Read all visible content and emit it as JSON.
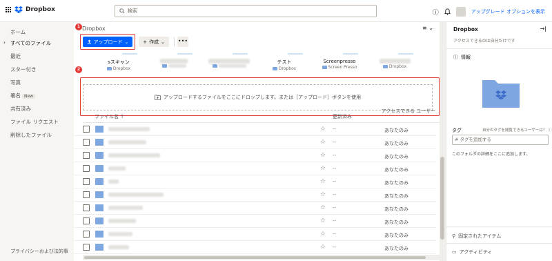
{
  "topbar": {
    "brand": "Dropbox",
    "search_placeholder": "検索",
    "upgrade_link": "アップグレード オプションを表示"
  },
  "sidebar": {
    "items": [
      {
        "label": "ホーム"
      },
      {
        "label": "すべてのファイル"
      },
      {
        "label": "最近"
      },
      {
        "label": "スター付き"
      },
      {
        "label": "写真"
      },
      {
        "label": "署名"
      },
      {
        "label": "共有済み"
      },
      {
        "label": "ファイル リクエスト"
      },
      {
        "label": "削除したファイル"
      }
    ],
    "new_badge": "New",
    "footer": "プライバシーおよび法的事"
  },
  "main": {
    "breadcrumb": "Dropbox",
    "badges": [
      "1",
      "2"
    ],
    "upload_label": "アップロード",
    "create_label": "作成",
    "more_label": "•••",
    "suggested": [
      {
        "title": "sスキャン",
        "sub": "Dropbox"
      },
      {
        "title": "",
        "sub": ""
      },
      {
        "title": "",
        "sub": ""
      },
      {
        "title": "テスト",
        "sub": "Dropbox"
      },
      {
        "title": "Screenpresso",
        "sub": "Screen Presso"
      },
      {
        "title": "",
        "sub": "Dropbox"
      }
    ],
    "dropzone_text": "アップロードするファイルをここにドロップします。または［アップロード］ボタンを使用",
    "columns": {
      "name": "ファイル名 ↑",
      "modified": "更新済み",
      "access": "アクセスできる ユーザー"
    },
    "rows": [
      {
        "modified": "--",
        "access": "あなたのみ"
      },
      {
        "modified": "--",
        "access": "あなたのみ"
      },
      {
        "modified": "--",
        "access": "あなたのみ"
      },
      {
        "modified": "--",
        "access": "あなたのみ"
      },
      {
        "modified": "--",
        "access": "あなたのみ"
      },
      {
        "modified": "--",
        "access": "あなたのみ"
      },
      {
        "modified": "--",
        "access": "あなたのみ"
      },
      {
        "modified": "--",
        "access": "あなたのみ"
      },
      {
        "modified": "--",
        "access": "あなたのみ"
      },
      {
        "modified": "--",
        "access": "あなたのみ"
      }
    ]
  },
  "rightpane": {
    "title": "Dropbox",
    "access_text": "アクセスできるのは自分だけです",
    "info_label": "情報",
    "tag_label": "タグ",
    "tag_hint": "自分のタグを閲覧できるユーザーは？",
    "tag_placeholder": "# タグを追加する",
    "folder_desc": "このフォルダの詳細をここに追加します。",
    "pinned_label": "固定されたアイテム",
    "activity_label": "アクティビティ"
  },
  "colors": {
    "accent": "#0061fe",
    "highlight": "#e53935",
    "folder": "#7ea6e0"
  }
}
